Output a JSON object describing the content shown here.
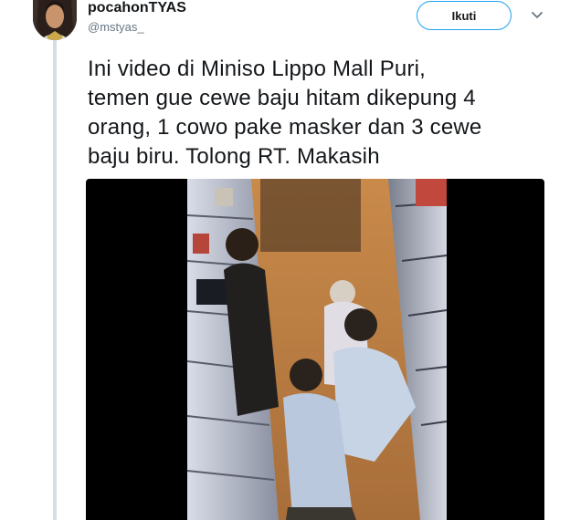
{
  "user": {
    "display_name": "pocahonTYAS",
    "handle": "@mstyas_"
  },
  "follow_button": {
    "label": "Ikuti"
  },
  "tweet": {
    "text": "Ini video di Miniso Lippo Mall Puri,\ntemen gue cewe baju hitam dikepung 4\norang, 1 cowo pake masker dan 3 cewe\nbaju biru. Tolong RT. Makasih"
  },
  "icons": {
    "more": "chevron-down-icon"
  },
  "colors": {
    "accent": "#1da1f2",
    "text": "#14171a",
    "muted": "#657786"
  }
}
